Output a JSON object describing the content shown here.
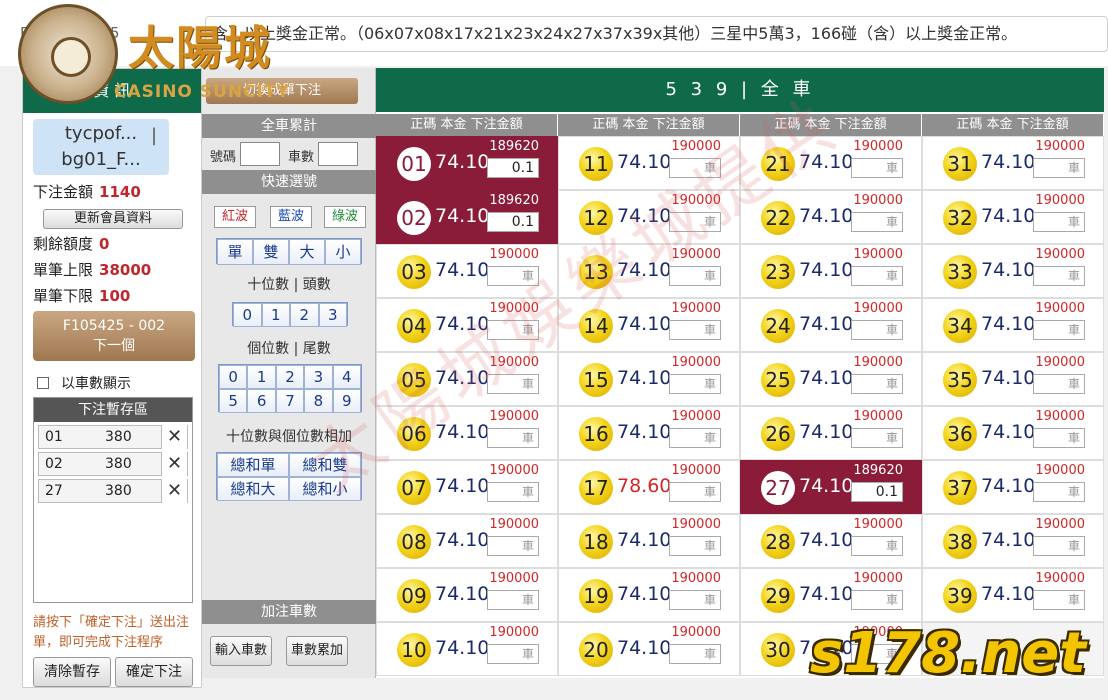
{
  "marquee": {
    "time": "F 3 1 9 13:15",
    "text": "含）以上獎金正常。（06x07x08x17x21x23x24x27x37x39x其他）三星中5萬3，166碰（含）以上獎金正常。"
  },
  "logo": {
    "cn": "太陽城",
    "en": "CASINO SUNCITY"
  },
  "left": {
    "header": "資 訊",
    "user_line1": "tycpof...",
    "user_line2": "bg01_F...",
    "user_sep": "|",
    "bet_amount_label": "下注金額",
    "bet_amount_value": "1140",
    "update_btn": "更新會員資料",
    "remaining_label": "剩餘額度",
    "remaining_value": "0",
    "max_label": "單筆上限",
    "max_value": "38000",
    "min_label": "單筆下限",
    "min_value": "100",
    "next_line1": "F105425 - 002",
    "next_line2": "下一個",
    "show_by_count": "以車數顯示",
    "temp_title": "下注暫存區",
    "temp_items": [
      {
        "num": "01",
        "amount": "380"
      },
      {
        "num": "02",
        "amount": "380"
      },
      {
        "num": "27",
        "amount": "380"
      }
    ],
    "hint": "請按下「確定下注」送出注單，即可完成下注程序",
    "clear_btn": "清除暫存",
    "confirm_btn": "確定下注"
  },
  "mid": {
    "top_btn": "切換成單下注",
    "total_title": "全車累計",
    "num_label": "號碼",
    "car_label": "車數",
    "quick_title": "快速選號",
    "waves": [
      "紅波",
      "藍波",
      "綠波"
    ],
    "parity": [
      "單",
      "雙",
      "大",
      "小"
    ],
    "tens_label": "十位數 | 頭數",
    "tens_keys": [
      "0",
      "1",
      "2",
      "3"
    ],
    "units_label": "個位數 | 尾數",
    "units_keys": [
      "0",
      "1",
      "2",
      "3",
      "4",
      "5",
      "6",
      "7",
      "8",
      "9"
    ],
    "sum_label": "十位數與個位數相加",
    "sum_keys": [
      "總和單",
      "總和雙",
      "總和大",
      "總和小"
    ],
    "add_title": "加注車數",
    "input_btn": "輸入車數",
    "accum_btn": "車數累加"
  },
  "main": {
    "title": "5 3 9 | 全 車",
    "col_head": "正碼 本金 下注金額",
    "placeholder": "車",
    "cells": [
      {
        "num": "01",
        "rate": "74.10",
        "limit": "189620",
        "value": "0.1",
        "selected": true
      },
      {
        "num": "11",
        "rate": "74.10",
        "limit": "190000",
        "value": "",
        "selected": false
      },
      {
        "num": "21",
        "rate": "74.10",
        "limit": "190000",
        "value": "",
        "selected": false
      },
      {
        "num": "31",
        "rate": "74.10",
        "limit": "190000",
        "value": "",
        "selected": false
      },
      {
        "num": "02",
        "rate": "74.10",
        "limit": "189620",
        "value": "0.1",
        "selected": true
      },
      {
        "num": "12",
        "rate": "74.10",
        "limit": "190000",
        "value": "",
        "selected": false
      },
      {
        "num": "22",
        "rate": "74.10",
        "limit": "190000",
        "value": "",
        "selected": false
      },
      {
        "num": "32",
        "rate": "74.10",
        "limit": "190000",
        "value": "",
        "selected": false
      },
      {
        "num": "03",
        "rate": "74.10",
        "limit": "190000",
        "value": "",
        "selected": false
      },
      {
        "num": "13",
        "rate": "74.10",
        "limit": "190000",
        "value": "",
        "selected": false
      },
      {
        "num": "23",
        "rate": "74.10",
        "limit": "190000",
        "value": "",
        "selected": false
      },
      {
        "num": "33",
        "rate": "74.10",
        "limit": "190000",
        "value": "",
        "selected": false
      },
      {
        "num": "04",
        "rate": "74.10",
        "limit": "190000",
        "value": "",
        "selected": false
      },
      {
        "num": "14",
        "rate": "74.10",
        "limit": "190000",
        "value": "",
        "selected": false
      },
      {
        "num": "24",
        "rate": "74.10",
        "limit": "190000",
        "value": "",
        "selected": false
      },
      {
        "num": "34",
        "rate": "74.10",
        "limit": "190000",
        "value": "",
        "selected": false
      },
      {
        "num": "05",
        "rate": "74.10",
        "limit": "190000",
        "value": "",
        "selected": false
      },
      {
        "num": "15",
        "rate": "74.10",
        "limit": "190000",
        "value": "",
        "selected": false
      },
      {
        "num": "25",
        "rate": "74.10",
        "limit": "190000",
        "value": "",
        "selected": false
      },
      {
        "num": "35",
        "rate": "74.10",
        "limit": "190000",
        "value": "",
        "selected": false
      },
      {
        "num": "06",
        "rate": "74.10",
        "limit": "190000",
        "value": "",
        "selected": false
      },
      {
        "num": "16",
        "rate": "74.10",
        "limit": "190000",
        "value": "",
        "selected": false
      },
      {
        "num": "26",
        "rate": "74.10",
        "limit": "190000",
        "value": "",
        "selected": false
      },
      {
        "num": "36",
        "rate": "74.10",
        "limit": "190000",
        "value": "",
        "selected": false
      },
      {
        "num": "07",
        "rate": "74.10",
        "limit": "190000",
        "value": "",
        "selected": false
      },
      {
        "num": "17",
        "rate": "78.60",
        "limit": "190000",
        "value": "",
        "selected": false,
        "highlight": true
      },
      {
        "num": "27",
        "rate": "74.10",
        "limit": "189620",
        "value": "0.1",
        "selected": true
      },
      {
        "num": "37",
        "rate": "74.10",
        "limit": "190000",
        "value": "",
        "selected": false
      },
      {
        "num": "08",
        "rate": "74.10",
        "limit": "190000",
        "value": "",
        "selected": false
      },
      {
        "num": "18",
        "rate": "74.10",
        "limit": "190000",
        "value": "",
        "selected": false
      },
      {
        "num": "28",
        "rate": "74.10",
        "limit": "190000",
        "value": "",
        "selected": false
      },
      {
        "num": "38",
        "rate": "74.10",
        "limit": "190000",
        "value": "",
        "selected": false
      },
      {
        "num": "09",
        "rate": "74.10",
        "limit": "190000",
        "value": "",
        "selected": false
      },
      {
        "num": "19",
        "rate": "74.10",
        "limit": "190000",
        "value": "",
        "selected": false
      },
      {
        "num": "29",
        "rate": "74.10",
        "limit": "190000",
        "value": "",
        "selected": false
      },
      {
        "num": "39",
        "rate": "74.10",
        "limit": "190000",
        "value": "",
        "selected": false
      },
      {
        "num": "10",
        "rate": "74.10",
        "limit": "190000",
        "value": "",
        "selected": false
      },
      {
        "num": "20",
        "rate": "74.10",
        "limit": "190000",
        "value": "",
        "selected": false
      },
      {
        "num": "30",
        "rate": "74.10",
        "limit": "190000",
        "value": "",
        "selected": false
      },
      {
        "num": "",
        "rate": "",
        "limit": "",
        "value": "",
        "selected": false,
        "empty": true
      }
    ]
  },
  "watermark": "太陽城娛樂城提供",
  "site_mark": "s178.net"
}
